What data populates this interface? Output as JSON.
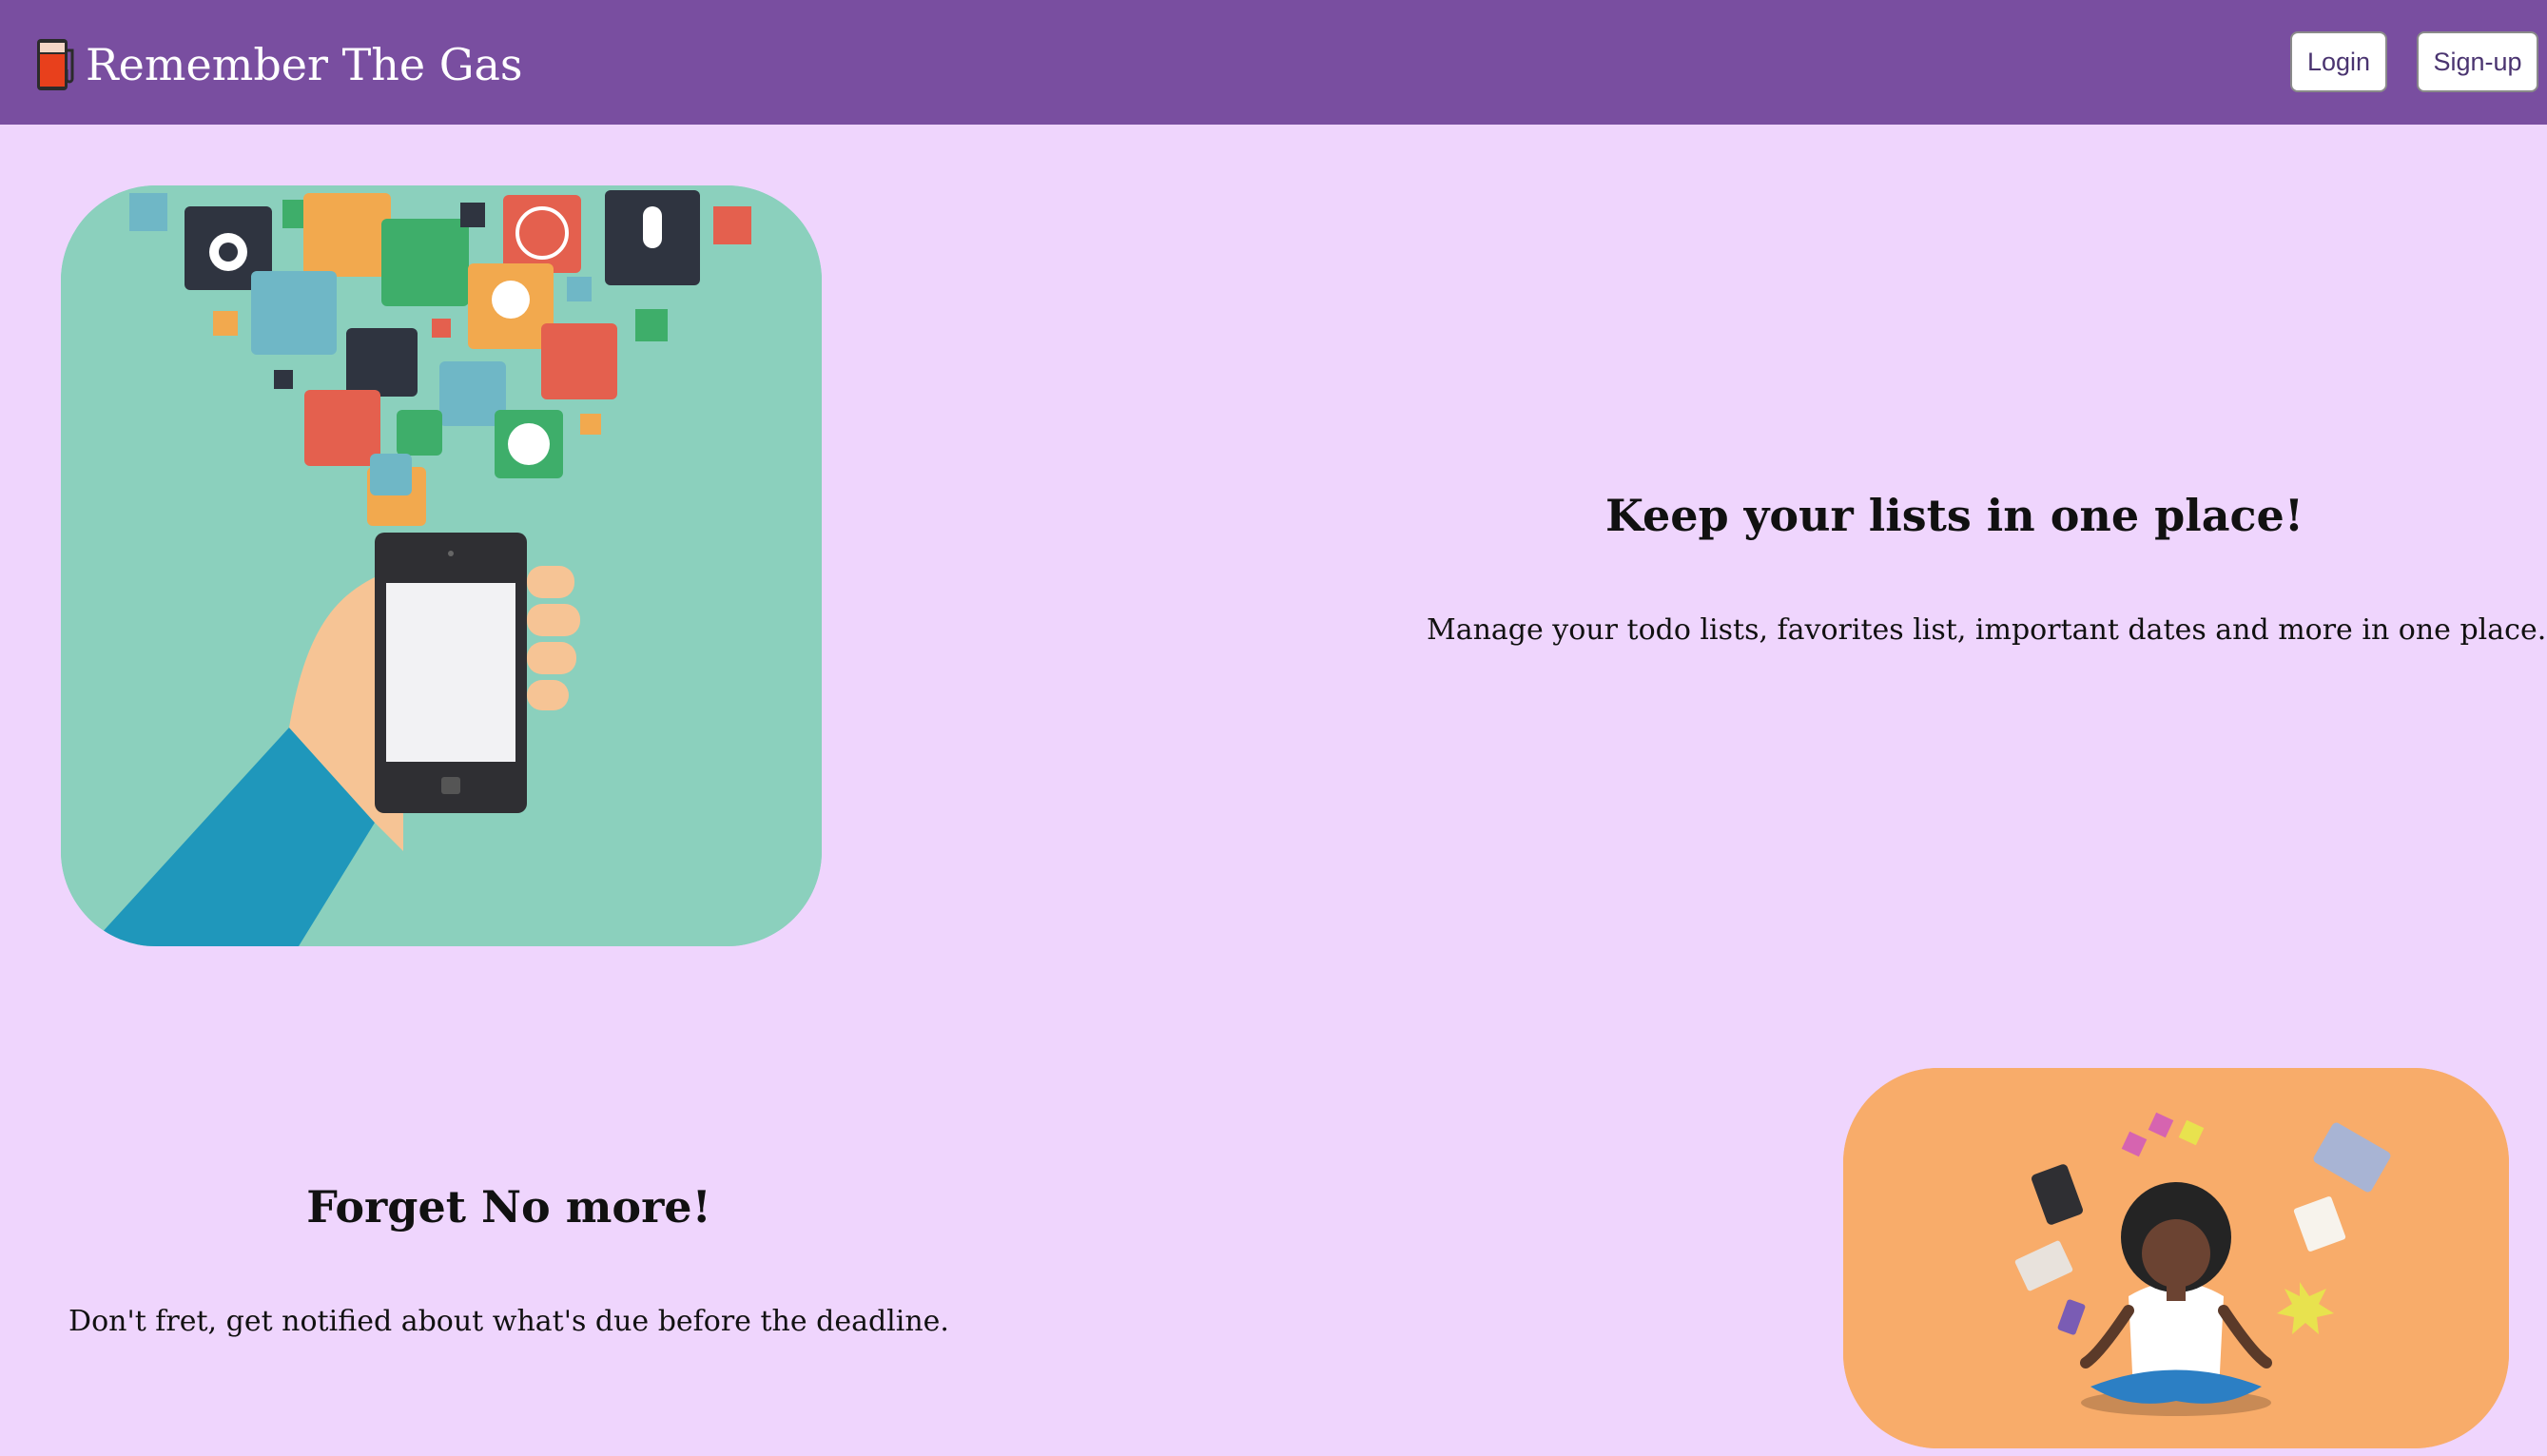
{
  "navbar": {
    "brand_text": "Remember The Gas",
    "brand_icon": "gas-pump-icon",
    "login_label": "Login",
    "signup_label": "Sign-up",
    "background": "#794ea0"
  },
  "page": {
    "background": "#efd5fd"
  },
  "features": [
    {
      "title": "Keep your lists in one place!",
      "text": "Manage your todo lists, favorites list, important dates and more in one place.",
      "image": "phone-apps-illustration"
    },
    {
      "title": "Forget No more!",
      "text": "Don't fret, get notified about what's due before the deadline.",
      "image": "meditating-person-illustration"
    }
  ]
}
